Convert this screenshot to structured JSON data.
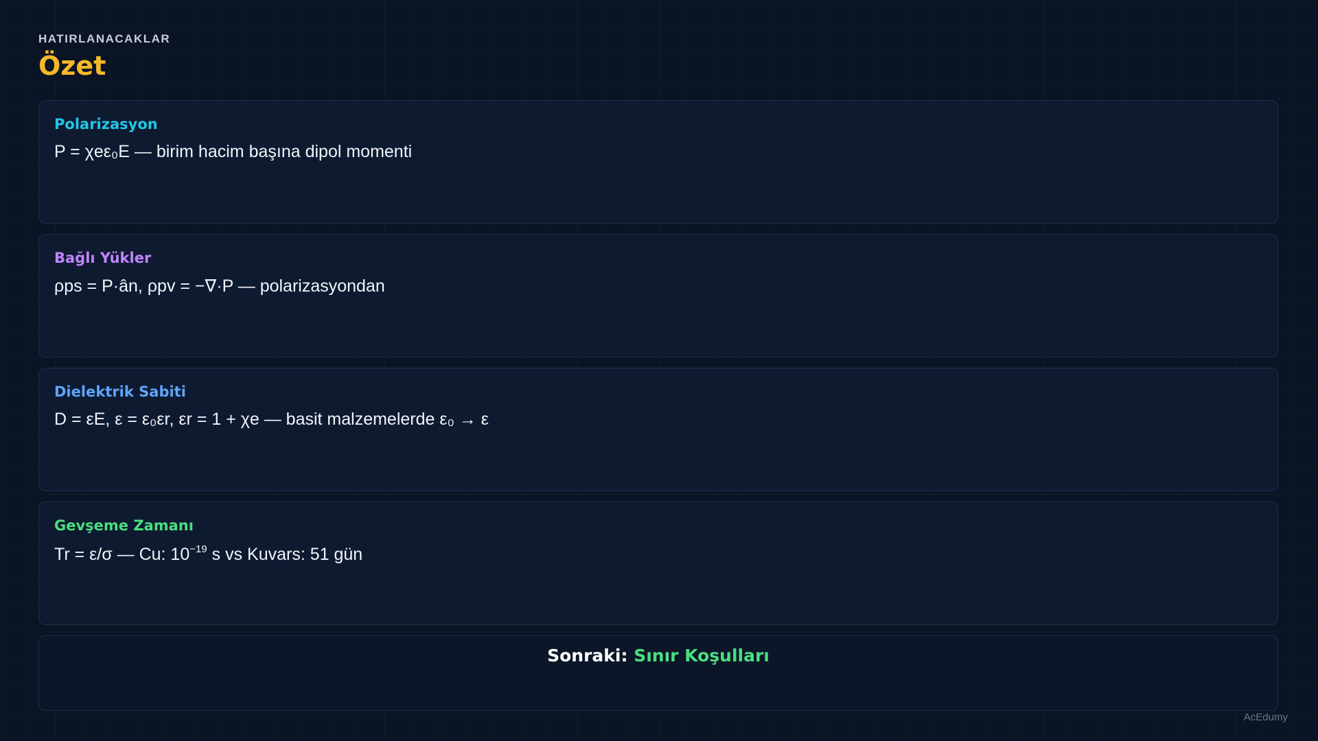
{
  "header": {
    "eyebrow": "HATIRLANACAKLAR",
    "title": "Özet"
  },
  "cards": [
    {
      "title": "Polarizasyon",
      "color": "#22c7e6",
      "body": "P = χeε₀E — birim hacim başına dipol momenti"
    },
    {
      "title": "Bağlı Yükler",
      "color": "#c084fc",
      "body": "ρps = P·ân, ρpv = −∇·P — polarizasyondan"
    },
    {
      "title": "Dielektrik Sabiti",
      "color": "#60a5fa",
      "body": "D = εE, ε = ε₀εr, εr = 1 + χe — basit malzemelerde ε₀ → ε"
    },
    {
      "title": "Gevşeme Zamanı",
      "color": "#4ade80",
      "body_before": "Tr = ε/σ — Cu: 10",
      "body_sup": "−19",
      "body_after": " s vs Kuvars: 51 gün"
    }
  ],
  "next": {
    "label": "Sonraki:",
    "target": "Sınır Koşulları",
    "label_color": "#ffffff",
    "target_color": "#4ade80"
  },
  "footer": {
    "brand": "AcEdumy"
  },
  "colors": {
    "background": "#0b1424",
    "accent": "#f5b82a"
  }
}
